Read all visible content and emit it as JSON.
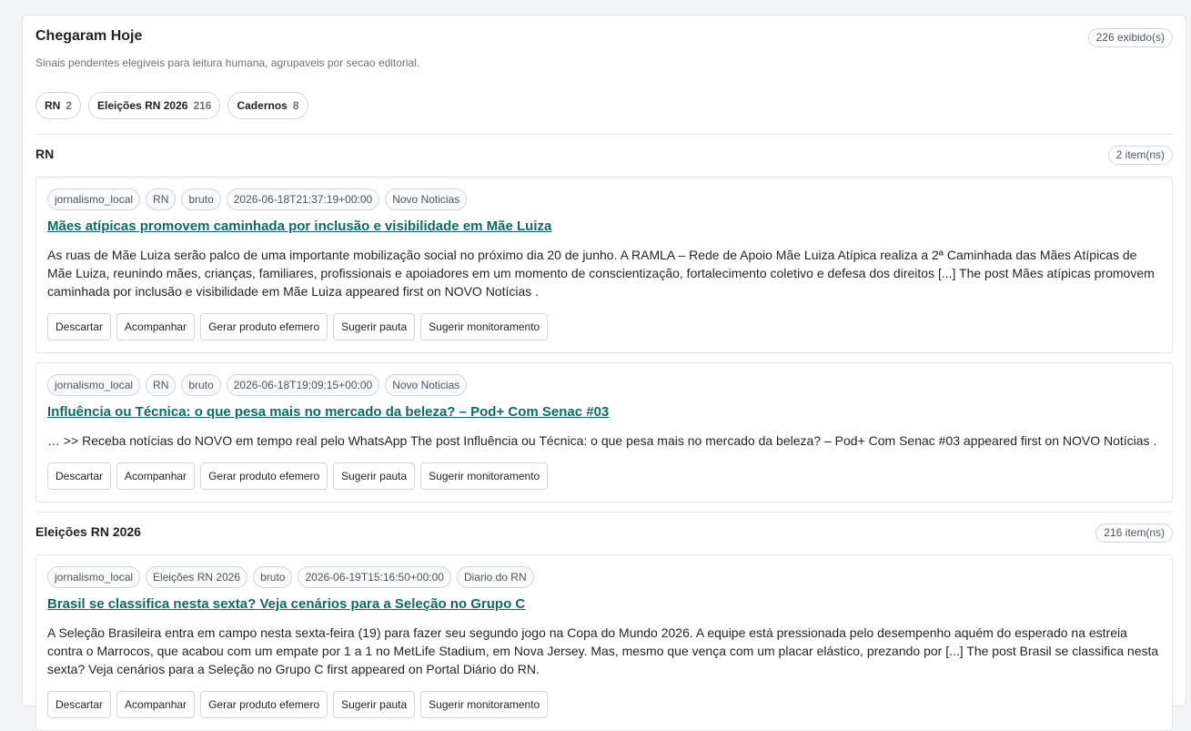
{
  "panel": {
    "title": "Chegaram Hoje",
    "subtitle": "Sinais pendentes elegiveis para leitura humana, agrupaveis por secao editorial.",
    "count": "226 exibido(s)"
  },
  "filters": [
    {
      "label": "RN",
      "count": "2"
    },
    {
      "label": "Eleições RN 2026",
      "count": "216"
    },
    {
      "label": "Cadernos",
      "count": "8"
    }
  ],
  "actions": [
    "Descartar",
    "Acompanhar",
    "Gerar produto efemero",
    "Sugerir pauta",
    "Sugerir monitoramento"
  ],
  "sections": [
    {
      "title": "RN",
      "count": "2 item(ns)",
      "items": [
        {
          "tags": [
            "jornalismo_local",
            "RN",
            "bruto",
            "2026-06-18T21:37:19+00:00",
            "Novo Noticias"
          ],
          "title": "Mães atípicas promovem caminhada por inclusão e visibilidade em Mãe Luiza",
          "body": "As ruas de Mãe Luiza serão palco de uma importante mobilização social no próximo dia 20 de junho. A RAMLA – Rede de Apoio Mãe Luiza Atípica realiza a 2ª Caminhada das Mães Atípicas de Mãe Luiza, reunindo mães, crianças, familiares, profissionais e apoiadores em um momento de conscientização, fortalecimento coletivo e defesa dos direitos [...] The post Mães atípicas promovem caminhada por inclusão e visibilidade em Mãe Luiza appeared first on NOVO Notícias ."
        },
        {
          "tags": [
            "jornalismo_local",
            "RN",
            "bruto",
            "2026-06-18T19:09:15+00:00",
            "Novo Noticias"
          ],
          "title": "Influência ou Técnica: o que pesa mais no mercado da beleza? – Pod+ Com Senac #03",
          "body": "… >> Receba notícias do NOVO em tempo real pelo WhatsApp The post Influência ou Técnica: o que pesa mais no mercado da beleza? – Pod+ Com Senac #03 appeared first on NOVO Notícias ."
        }
      ]
    },
    {
      "title": "Eleições RN 2026",
      "count": "216 item(ns)",
      "items": [
        {
          "tags": [
            "jornalismo_local",
            "Eleições RN 2026",
            "bruto",
            "2026-06-19T15:16:50+00:00",
            "Diario do RN"
          ],
          "title": "Brasil se classifica nesta sexta? Veja cenários para a Seleção no Grupo C",
          "body": "A Seleção Brasileira entra em campo nesta sexta-feira (19) para fazer seu segundo jogo na Copa do Mundo 2026. A equipe está pressionada pelo desempenho aquém do esperado na estreia contra o Marrocos, que acabou com um empate por 1 a 1 no MetLife Stadium, em Nova Jersey. Mas, mesmo que vença com um placar elástico, prezando por [...] The post Brasil se classifica nesta sexta? Veja cenários para a Seleção no Grupo C first appeared on Portal Diário do RN."
        }
      ]
    }
  ]
}
